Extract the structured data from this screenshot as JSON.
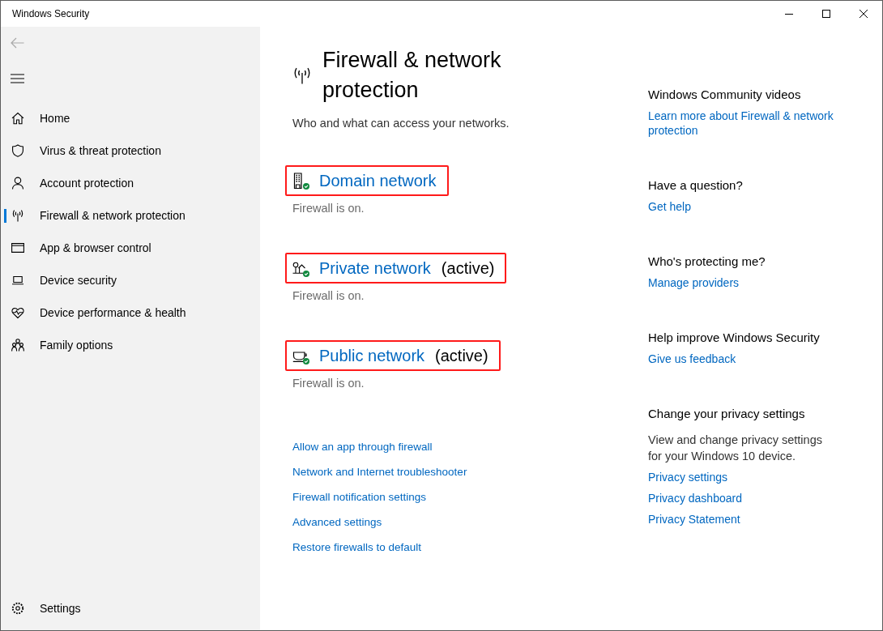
{
  "window": {
    "title": "Windows Security"
  },
  "sidebar": {
    "back": {
      "disabled": true
    },
    "items": [
      {
        "label": "Home",
        "kind": "home",
        "selected": false
      },
      {
        "label": "Virus & threat protection",
        "kind": "shield",
        "selected": false
      },
      {
        "label": "Account protection",
        "kind": "account",
        "selected": false
      },
      {
        "label": "Firewall & network protection",
        "kind": "network",
        "selected": true
      },
      {
        "label": "App & browser control",
        "kind": "app",
        "selected": false
      },
      {
        "label": "Device security",
        "kind": "device",
        "selected": false
      },
      {
        "label": "Device performance & health",
        "kind": "health",
        "selected": false
      },
      {
        "label": "Family options",
        "kind": "family",
        "selected": false
      }
    ],
    "settings": {
      "label": "Settings"
    }
  },
  "page": {
    "title": "Firewall & network protection",
    "subtitle": "Who and what can access your networks.",
    "networks": [
      {
        "kind": "domain",
        "name": "Domain network",
        "status": "Firewall is on.",
        "highlighted": true
      },
      {
        "kind": "private",
        "name": "Private network",
        "note": "(active)",
        "status": "Firewall is on.",
        "highlighted": true
      },
      {
        "kind": "public",
        "name": "Public network",
        "note": "(active)",
        "status": "Firewall is on.",
        "highlighted": true
      }
    ],
    "links": [
      "Allow an app through firewall",
      "Network and Internet troubleshooter",
      "Firewall notification settings",
      "Advanced settings",
      "Restore firewalls to default"
    ]
  },
  "aside": {
    "sections": [
      {
        "heading": "Windows Community videos",
        "links": [
          "Learn more about Firewall & network protection"
        ]
      },
      {
        "heading": "Have a question?",
        "links": [
          "Get help"
        ]
      },
      {
        "heading": "Who's protecting me?",
        "links": [
          "Manage providers"
        ]
      },
      {
        "heading": "Help improve Windows Security",
        "links": [
          "Give us feedback"
        ]
      },
      {
        "heading": "Change your privacy settings",
        "text": "View and change privacy settings for your Windows 10 device.",
        "links": [
          "Privacy settings",
          "Privacy dashboard",
          "Privacy Statement"
        ]
      }
    ]
  }
}
